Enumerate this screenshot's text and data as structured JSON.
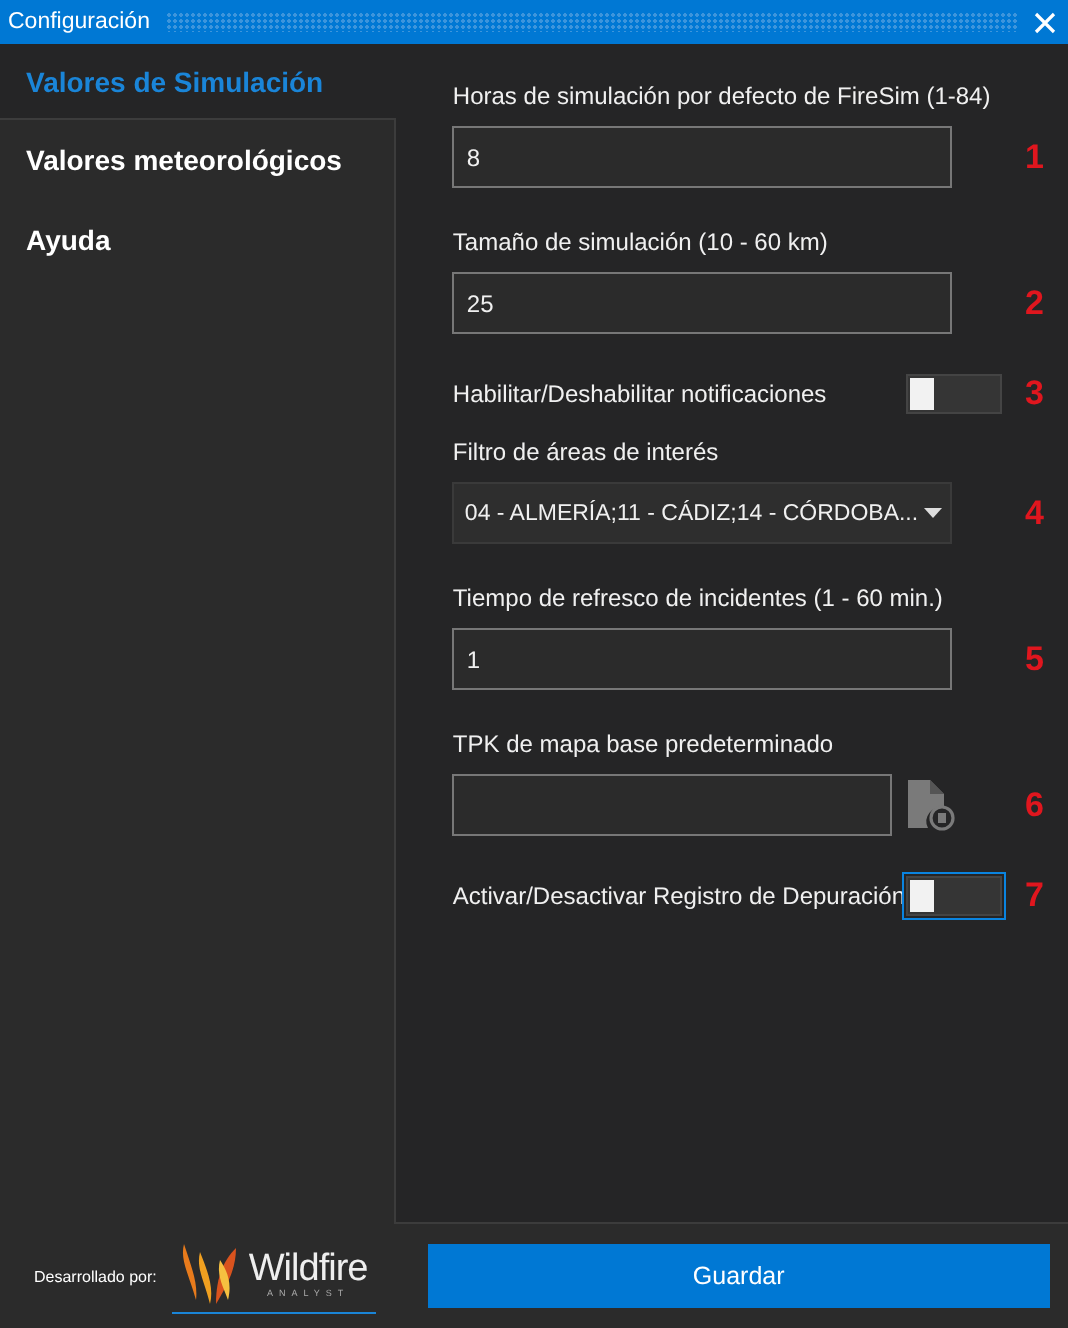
{
  "window": {
    "title": "Configuración"
  },
  "sidebar": {
    "items": [
      {
        "label": "Valores de Simulación",
        "selected": true
      },
      {
        "label": "Valores meteorológicos",
        "selected": false
      },
      {
        "label": "Ayuda",
        "selected": false
      }
    ]
  },
  "fields": [
    {
      "kind": "text",
      "label": "Horas de simulación por defecto de FireSim (1-84)",
      "value": "8",
      "marker": "1"
    },
    {
      "kind": "text",
      "label": "Tamaño de simulación (10 - 60 km)",
      "value": "25",
      "marker": "2"
    },
    {
      "kind": "toggle",
      "label": "Habilitar/Deshabilitar notificaciones",
      "on": false,
      "focused": false,
      "marker": "3"
    },
    {
      "kind": "dropdown",
      "label": "Filtro de áreas de interés",
      "value": "04 - ALMERÍA;11 - CÁDIZ;14 - CÓRDOBA...",
      "marker": "4"
    },
    {
      "kind": "text",
      "label": "Tiempo de refresco de incidentes (1 - 60 min.)",
      "value": "1",
      "marker": "5"
    },
    {
      "kind": "file",
      "label": "TPK de mapa base predeterminado",
      "marker": "6"
    },
    {
      "kind": "toggle",
      "label": "Activar/Desactivar Registro de Depuración",
      "on": false,
      "focused": true,
      "marker": "7"
    }
  ],
  "footer": {
    "credit": "Desarrollado por:",
    "logo_name": "Wildfire",
    "logo_sub": "ANALYST",
    "save_button": "Guardar"
  }
}
